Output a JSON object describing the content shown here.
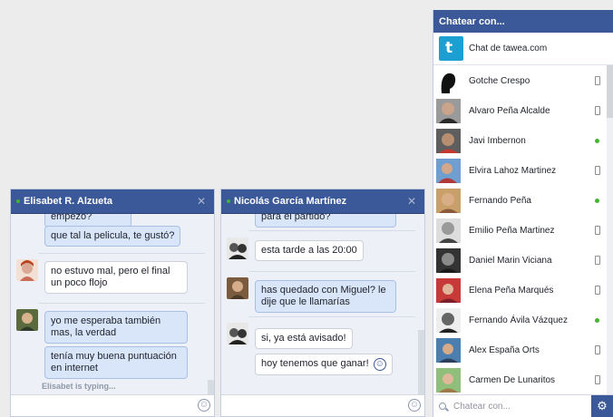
{
  "chat1": {
    "title": "Elisabet R. Alzueta",
    "messages": [
      {
        "text": "empezo?",
        "from": "me"
      },
      {
        "text": "que tal la pelicula, te gustó?",
        "from": "me"
      },
      {
        "text": "no estuvo mal, pero el final un poco flojo",
        "from": "them"
      },
      {
        "text": "yo me esperaba también mas, la verdad",
        "from": "me"
      },
      {
        "text": "tenía muy buena puntuación en internet",
        "from": "me"
      }
    ],
    "typing": "Elisabet is typing..."
  },
  "chat2": {
    "title": "Nicolás García Martínez",
    "messages": [
      {
        "text": "para el partido?",
        "from": "me"
      },
      {
        "text": "esta tarde a las 20:00",
        "from": "them"
      },
      {
        "text": "has quedado con Miguel? le dije que le llamarías",
        "from": "me"
      },
      {
        "text": "si, ya está avisado!",
        "from": "them"
      },
      {
        "text": "hoy tenemos que ganar!",
        "from": "them"
      }
    ]
  },
  "sidebar": {
    "title": "Chatear con...",
    "app_name": "Chat de tawea.com",
    "search_placeholder": "Chatear con...",
    "contacts": [
      {
        "name": "Gotche Crespo",
        "status": "mobile"
      },
      {
        "name": "Alvaro Peña Alcalde",
        "status": "mobile"
      },
      {
        "name": "Javi Imbernon",
        "status": "online"
      },
      {
        "name": "Elvira Lahoz Martinez",
        "status": "mobile"
      },
      {
        "name": "Fernando Peña",
        "status": "online"
      },
      {
        "name": "Emilio Peña Martinez",
        "status": "mobile"
      },
      {
        "name": "Daniel Marin Viciana",
        "status": "mobile"
      },
      {
        "name": "Elena Peña Marqués",
        "status": "mobile"
      },
      {
        "name": "Fernando Ávila Vázquez",
        "status": "online"
      },
      {
        "name": "Alex España Orts",
        "status": "mobile"
      },
      {
        "name": "Carmen De Lunaritos",
        "status": "mobile"
      }
    ]
  },
  "colors": {
    "header": "#3b5998",
    "online": "#42b72a",
    "bubble_me": "#d9e6fa"
  }
}
